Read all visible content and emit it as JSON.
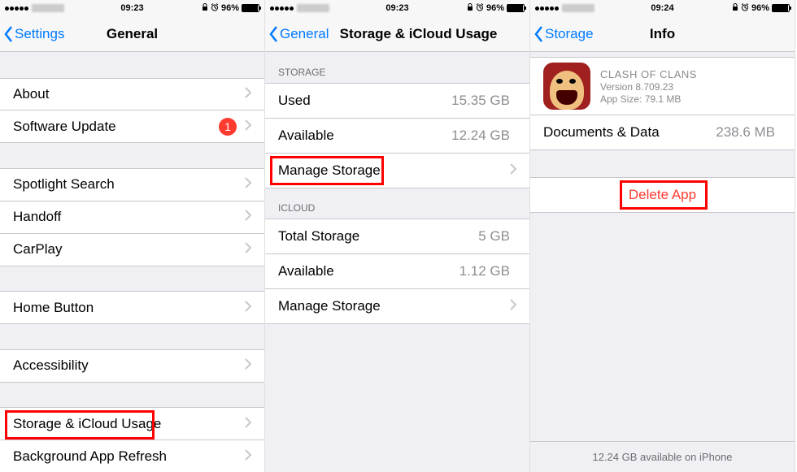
{
  "status": {
    "time_a": "09:23",
    "time_c": "09:24",
    "battery_pct": "96%"
  },
  "panel1": {
    "back": "Settings",
    "title": "General",
    "items": {
      "about": "About",
      "software_update": "Software Update",
      "badge": "1",
      "spotlight": "Spotlight Search",
      "handoff": "Handoff",
      "carplay": "CarPlay",
      "home_button": "Home Button",
      "accessibility": "Accessibility",
      "storage_icloud": "Storage & iCloud Usage",
      "background_refresh": "Background App Refresh"
    }
  },
  "panel2": {
    "back": "General",
    "title": "Storage & iCloud Usage",
    "section_storage": "Storage",
    "section_icloud": "iCloud",
    "storage": {
      "used_label": "Used",
      "used_value": "15.35 GB",
      "available_label": "Available",
      "available_value": "12.24 GB",
      "manage_label": "Manage Storage"
    },
    "icloud": {
      "total_label": "Total Storage",
      "total_value": "5 GB",
      "available_label": "Available",
      "available_value": "1.12 GB",
      "manage_label": "Manage Storage"
    }
  },
  "panel3": {
    "back": "Storage",
    "title": "Info",
    "app": {
      "name": "CLASH OF CLANS",
      "version": "Version 8.709.23",
      "size": "App Size: 79.1 MB"
    },
    "docs_label": "Documents & Data",
    "docs_value": "238.6 MB",
    "delete": "Delete App",
    "footer": "12.24 GB available on iPhone"
  }
}
